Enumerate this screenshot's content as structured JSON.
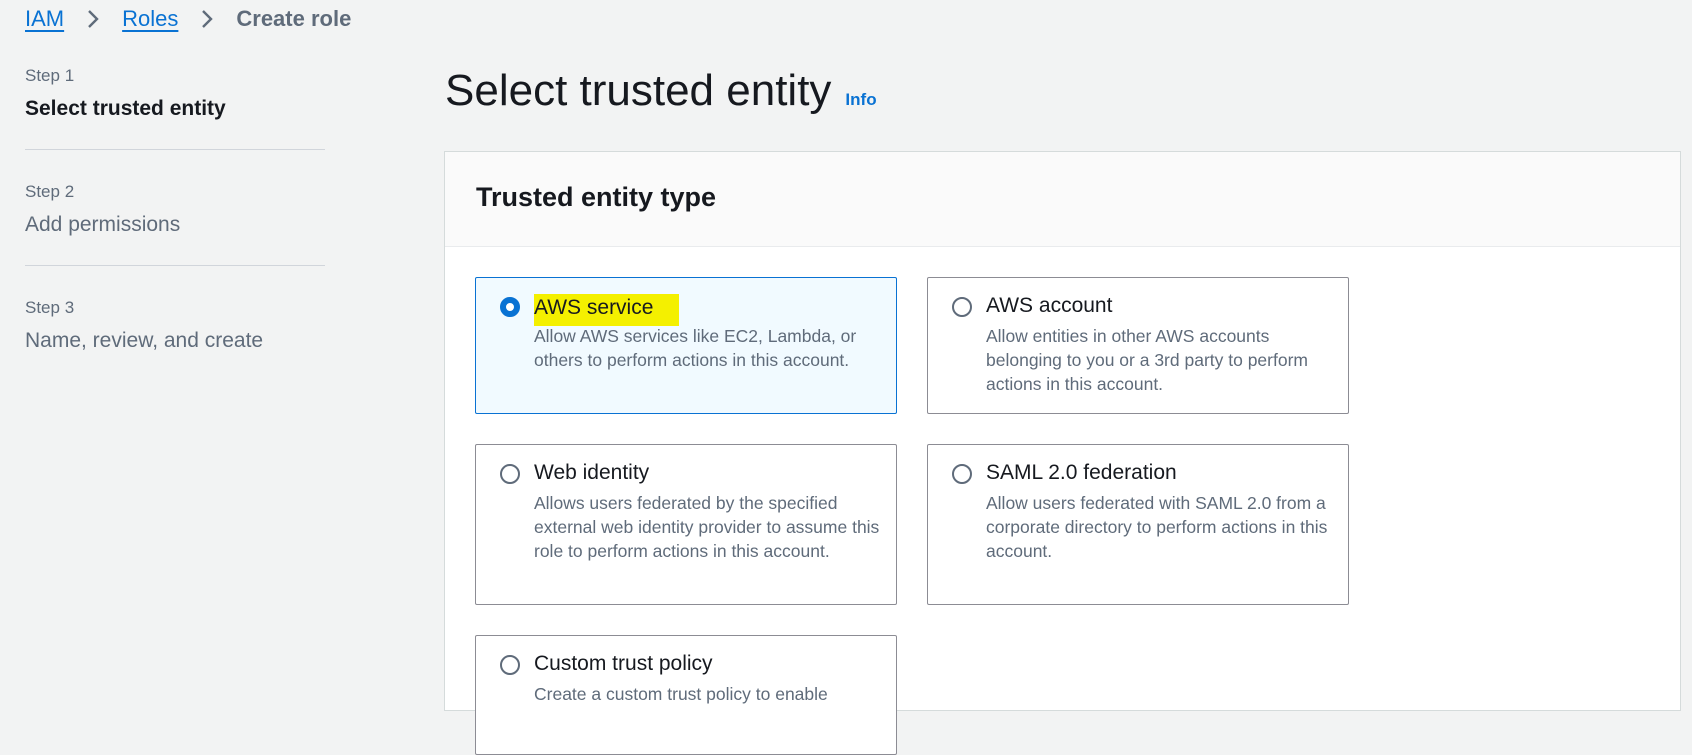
{
  "breadcrumb": {
    "items": [
      "IAM",
      "Roles"
    ],
    "current": "Create role"
  },
  "steps": [
    {
      "number": "Step 1",
      "title": "Select trusted entity",
      "active": true
    },
    {
      "number": "Step 2",
      "title": "Add permissions",
      "active": false
    },
    {
      "number": "Step 3",
      "title": "Name, review, and create",
      "active": false
    }
  ],
  "page": {
    "title": "Select trusted entity",
    "info_label": "Info"
  },
  "panel": {
    "title": "Trusted entity type",
    "options": [
      {
        "title": "AWS service",
        "description": "Allow AWS services like EC2, Lambda, or others to perform actions in this account.",
        "selected": true
      },
      {
        "title": "AWS account",
        "description": "Allow entities in other AWS accounts belonging to you or a 3rd party to perform actions in this account.",
        "selected": false
      },
      {
        "title": "Web identity",
        "description": "Allows users federated by the specified external web identity provider to assume this role to perform actions in this account.",
        "selected": false
      },
      {
        "title": "SAML 2.0 federation",
        "description": "Allow users federated with SAML 2.0 from a corporate directory to perform actions in this account.",
        "selected": false
      },
      {
        "title": "Custom trust policy",
        "description": "Create a custom trust policy to enable",
        "selected": false
      }
    ]
  },
  "colors": {
    "link": "#0972d3",
    "selected_tile_bg": "#f1faff",
    "highlight": "#f4f000"
  },
  "icons": {
    "breadcrumb_separator": "chevron-right-icon"
  }
}
